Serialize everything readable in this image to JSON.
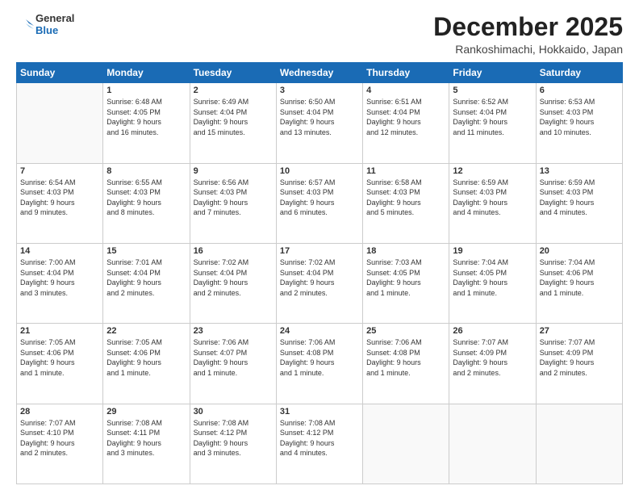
{
  "logo": {
    "line1": "General",
    "line2": "Blue"
  },
  "title": "December 2025",
  "subtitle": "Rankoshimachi, Hokkaido, Japan",
  "headers": [
    "Sunday",
    "Monday",
    "Tuesday",
    "Wednesday",
    "Thursday",
    "Friday",
    "Saturday"
  ],
  "weeks": [
    [
      {
        "day": "",
        "info": ""
      },
      {
        "day": "1",
        "info": "Sunrise: 6:48 AM\nSunset: 4:05 PM\nDaylight: 9 hours\nand 16 minutes."
      },
      {
        "day": "2",
        "info": "Sunrise: 6:49 AM\nSunset: 4:04 PM\nDaylight: 9 hours\nand 15 minutes."
      },
      {
        "day": "3",
        "info": "Sunrise: 6:50 AM\nSunset: 4:04 PM\nDaylight: 9 hours\nand 13 minutes."
      },
      {
        "day": "4",
        "info": "Sunrise: 6:51 AM\nSunset: 4:04 PM\nDaylight: 9 hours\nand 12 minutes."
      },
      {
        "day": "5",
        "info": "Sunrise: 6:52 AM\nSunset: 4:04 PM\nDaylight: 9 hours\nand 11 minutes."
      },
      {
        "day": "6",
        "info": "Sunrise: 6:53 AM\nSunset: 4:03 PM\nDaylight: 9 hours\nand 10 minutes."
      }
    ],
    [
      {
        "day": "7",
        "info": "Sunrise: 6:54 AM\nSunset: 4:03 PM\nDaylight: 9 hours\nand 9 minutes."
      },
      {
        "day": "8",
        "info": "Sunrise: 6:55 AM\nSunset: 4:03 PM\nDaylight: 9 hours\nand 8 minutes."
      },
      {
        "day": "9",
        "info": "Sunrise: 6:56 AM\nSunset: 4:03 PM\nDaylight: 9 hours\nand 7 minutes."
      },
      {
        "day": "10",
        "info": "Sunrise: 6:57 AM\nSunset: 4:03 PM\nDaylight: 9 hours\nand 6 minutes."
      },
      {
        "day": "11",
        "info": "Sunrise: 6:58 AM\nSunset: 4:03 PM\nDaylight: 9 hours\nand 5 minutes."
      },
      {
        "day": "12",
        "info": "Sunrise: 6:59 AM\nSunset: 4:03 PM\nDaylight: 9 hours\nand 4 minutes."
      },
      {
        "day": "13",
        "info": "Sunrise: 6:59 AM\nSunset: 4:03 PM\nDaylight: 9 hours\nand 4 minutes."
      }
    ],
    [
      {
        "day": "14",
        "info": "Sunrise: 7:00 AM\nSunset: 4:04 PM\nDaylight: 9 hours\nand 3 minutes."
      },
      {
        "day": "15",
        "info": "Sunrise: 7:01 AM\nSunset: 4:04 PM\nDaylight: 9 hours\nand 2 minutes."
      },
      {
        "day": "16",
        "info": "Sunrise: 7:02 AM\nSunset: 4:04 PM\nDaylight: 9 hours\nand 2 minutes."
      },
      {
        "day": "17",
        "info": "Sunrise: 7:02 AM\nSunset: 4:04 PM\nDaylight: 9 hours\nand 2 minutes."
      },
      {
        "day": "18",
        "info": "Sunrise: 7:03 AM\nSunset: 4:05 PM\nDaylight: 9 hours\nand 1 minute."
      },
      {
        "day": "19",
        "info": "Sunrise: 7:04 AM\nSunset: 4:05 PM\nDaylight: 9 hours\nand 1 minute."
      },
      {
        "day": "20",
        "info": "Sunrise: 7:04 AM\nSunset: 4:06 PM\nDaylight: 9 hours\nand 1 minute."
      }
    ],
    [
      {
        "day": "21",
        "info": "Sunrise: 7:05 AM\nSunset: 4:06 PM\nDaylight: 9 hours\nand 1 minute."
      },
      {
        "day": "22",
        "info": "Sunrise: 7:05 AM\nSunset: 4:06 PM\nDaylight: 9 hours\nand 1 minute."
      },
      {
        "day": "23",
        "info": "Sunrise: 7:06 AM\nSunset: 4:07 PM\nDaylight: 9 hours\nand 1 minute."
      },
      {
        "day": "24",
        "info": "Sunrise: 7:06 AM\nSunset: 4:08 PM\nDaylight: 9 hours\nand 1 minute."
      },
      {
        "day": "25",
        "info": "Sunrise: 7:06 AM\nSunset: 4:08 PM\nDaylight: 9 hours\nand 1 minute."
      },
      {
        "day": "26",
        "info": "Sunrise: 7:07 AM\nSunset: 4:09 PM\nDaylight: 9 hours\nand 2 minutes."
      },
      {
        "day": "27",
        "info": "Sunrise: 7:07 AM\nSunset: 4:09 PM\nDaylight: 9 hours\nand 2 minutes."
      }
    ],
    [
      {
        "day": "28",
        "info": "Sunrise: 7:07 AM\nSunset: 4:10 PM\nDaylight: 9 hours\nand 2 minutes."
      },
      {
        "day": "29",
        "info": "Sunrise: 7:08 AM\nSunset: 4:11 PM\nDaylight: 9 hours\nand 3 minutes."
      },
      {
        "day": "30",
        "info": "Sunrise: 7:08 AM\nSunset: 4:12 PM\nDaylight: 9 hours\nand 3 minutes."
      },
      {
        "day": "31",
        "info": "Sunrise: 7:08 AM\nSunset: 4:12 PM\nDaylight: 9 hours\nand 4 minutes."
      },
      {
        "day": "",
        "info": ""
      },
      {
        "day": "",
        "info": ""
      },
      {
        "day": "",
        "info": ""
      }
    ]
  ]
}
